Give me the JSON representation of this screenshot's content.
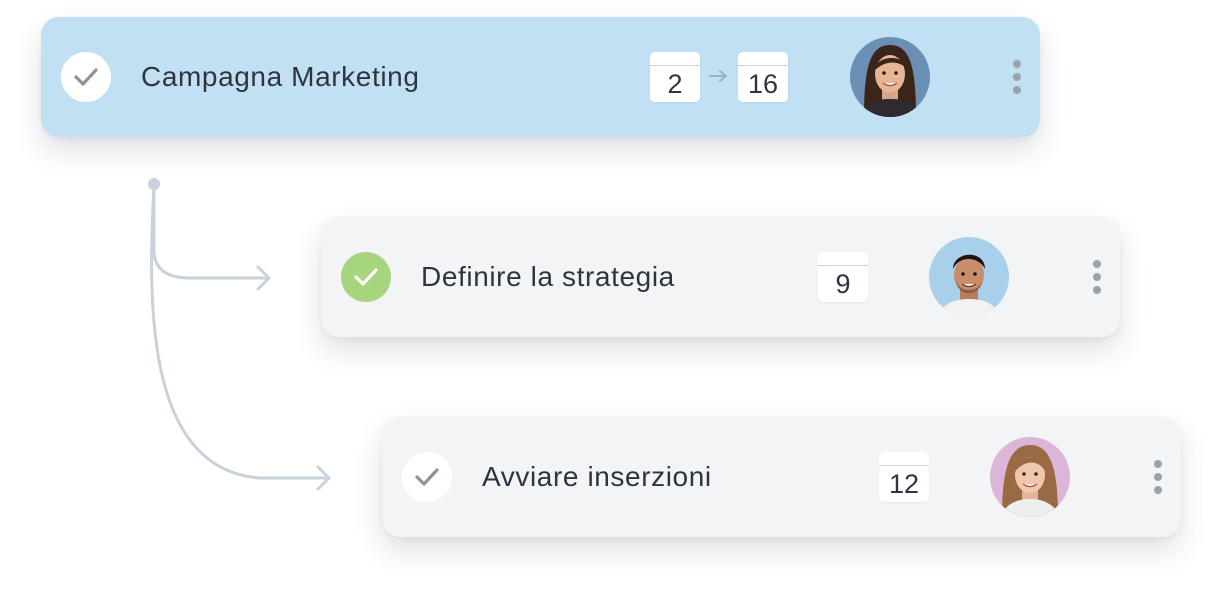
{
  "colors": {
    "parent_card_bg": "#c2e0f3",
    "subtask_card_bg": "#f3f4f6",
    "completed_check": "#a6d57e",
    "connector": "#c8d2dc",
    "text": "#2f3540"
  },
  "tasks": [
    {
      "title": "Campagna Marketing",
      "level": "parent",
      "completed": false,
      "start_day": "2",
      "end_day": "16",
      "assignee_avatar": "woman-dark-hair-avatar",
      "menu_icon": "more-vertical-icon"
    },
    {
      "title": "Definire la strategia",
      "level": "subtask",
      "completed": true,
      "due_day": "9",
      "assignee_avatar": "man-dark-hair-avatar",
      "menu_icon": "more-vertical-icon"
    },
    {
      "title": "Avviare inserzioni",
      "level": "subtask",
      "completed": false,
      "due_day": "12",
      "assignee_avatar": "woman-blonde-hair-avatar",
      "menu_icon": "more-vertical-icon"
    }
  ]
}
